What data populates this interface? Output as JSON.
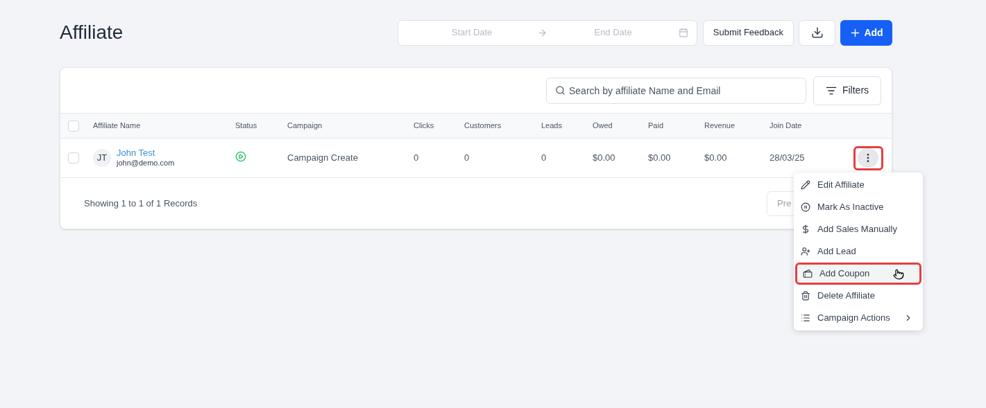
{
  "page": {
    "title": "Affiliate"
  },
  "date_range": {
    "start_placeholder": "Start Date",
    "end_placeholder": "End Date"
  },
  "toolbar": {
    "feedback_button": "Submit Feedback",
    "add_button": "Add"
  },
  "search": {
    "placeholder": "Search by affiliate Name and Email"
  },
  "filters_button": "Filters",
  "table": {
    "columns": [
      "Affiliate Name",
      "Status",
      "Campaign",
      "Clicks",
      "Customers",
      "Leads",
      "Owed",
      "Paid",
      "Revenue",
      "Join Date"
    ],
    "select_all": {
      "checked": false
    },
    "rows": [
      {
        "checked": false,
        "initials": "JT",
        "name": "John Test",
        "email": "john@demo.com",
        "active": true,
        "campaign": "Campaign Create",
        "clicks": "0",
        "customers": "0",
        "leads": "0",
        "owed": "$0.00",
        "paid": "$0.00",
        "revenue": "$0.00",
        "join_date": "28/03/25",
        "menu_open": true,
        "highlighted": true
      }
    ]
  },
  "footer": {
    "summary": "Showing 1 to 1 of 1 Records",
    "prev_button": "Pre"
  },
  "menu": {
    "items": [
      {
        "kind": "edit",
        "label": "Edit Affiliate",
        "highlighted": false
      },
      {
        "kind": "pause",
        "label": "Mark As Inactive",
        "highlighted": false
      },
      {
        "kind": "dollar",
        "label": "Add Sales Manually",
        "highlighted": false
      },
      {
        "kind": "user-plus",
        "label": "Add Lead",
        "highlighted": false
      },
      {
        "kind": "coupon",
        "label": "Add Coupon",
        "highlighted": true
      },
      {
        "kind": "trash",
        "label": "Delete Affiliate",
        "highlighted": false
      },
      {
        "kind": "list",
        "label": "Campaign Actions",
        "highlighted": false,
        "submenu": true
      }
    ]
  }
}
